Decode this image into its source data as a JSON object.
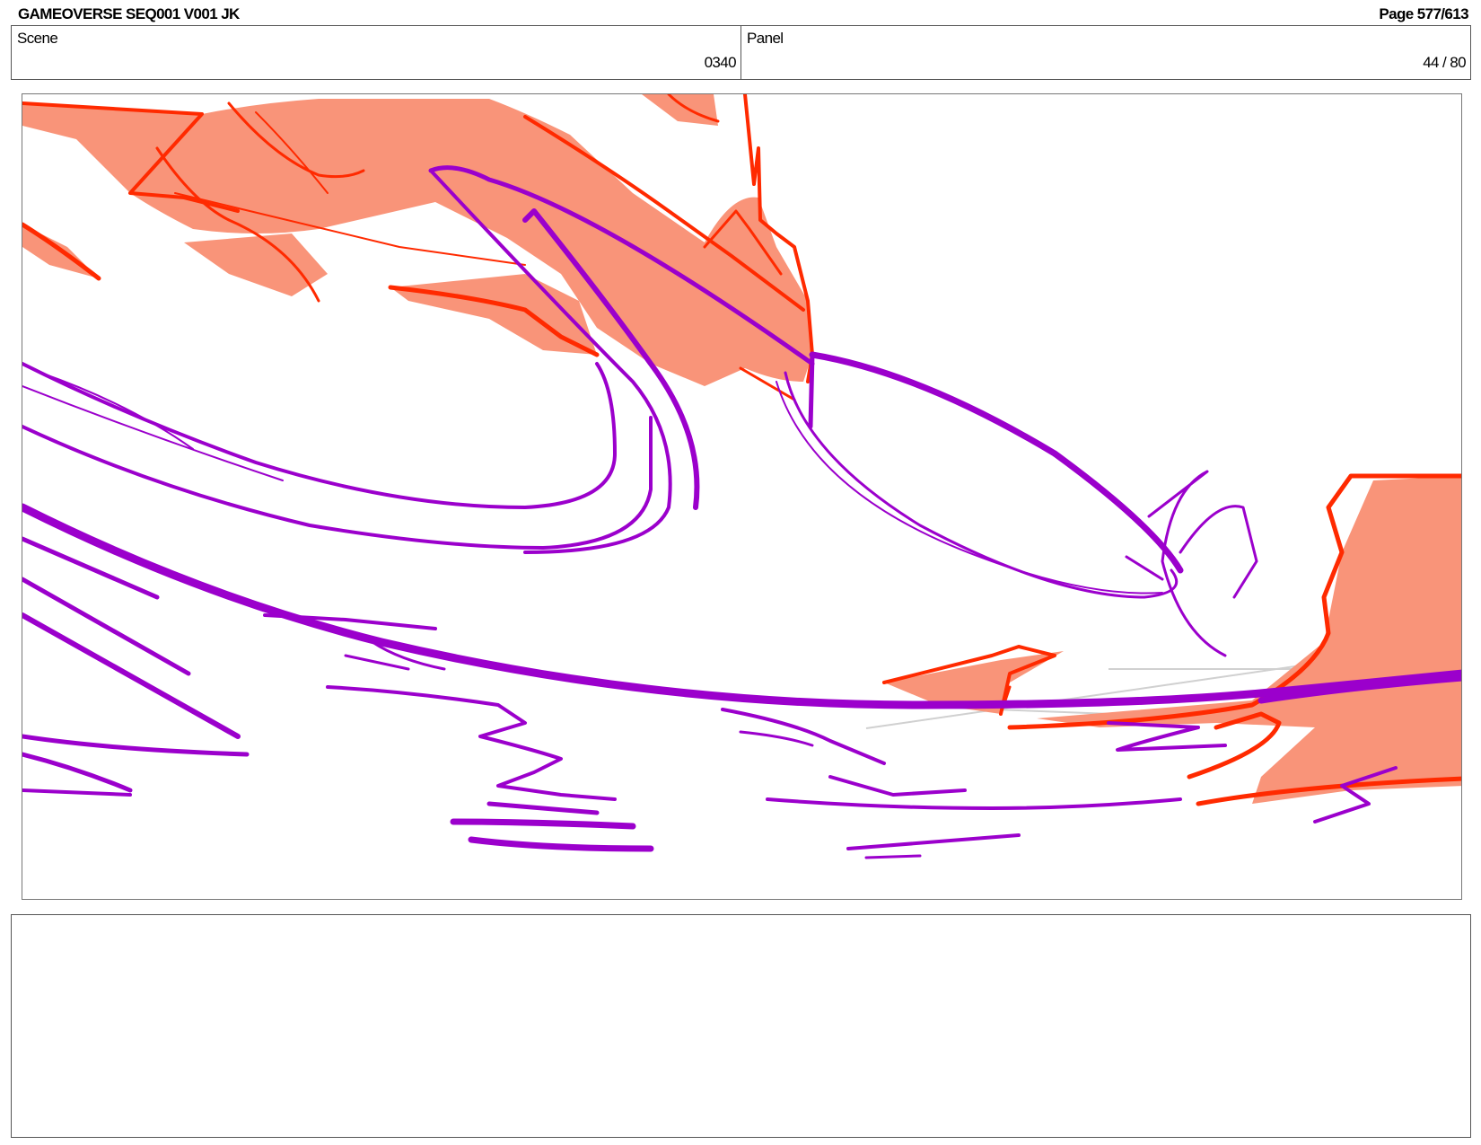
{
  "header": {
    "title": "GAMEOVERSE SEQ001 V001 JK",
    "page": "Page 577/613"
  },
  "info": {
    "scene_label": "Scene",
    "scene_value": "0340",
    "panel_label": "Panel",
    "panel_value": "44 / 80"
  },
  "drawing": {
    "fill_color": "#f99479",
    "red_line_color": "#ff2a00",
    "purple_line_color": "#9b00cc",
    "guide_color": "#d0d0d0"
  },
  "notes": {
    "text": ""
  }
}
